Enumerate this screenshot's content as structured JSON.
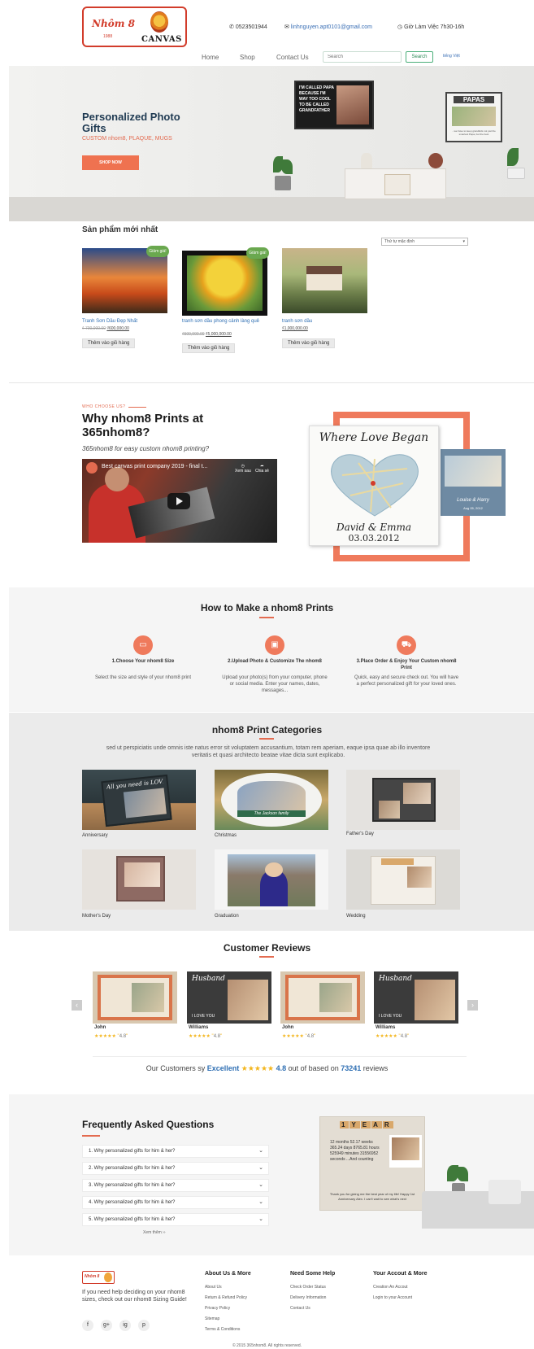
{
  "header": {
    "logo_text": "Nhôm 8",
    "logo_sub": "1988",
    "logo_canvas": "CANVAS",
    "phone": "0523501944",
    "email": "linhnguyen.apt0101@gmail.com",
    "hours": "Giờ Làm Việc 7h30-16h",
    "nav": [
      "Home",
      "Shop",
      "Contact Us"
    ],
    "search_placeholder": "Search",
    "search_button": "Search",
    "language": "tiếng Việt"
  },
  "hero": {
    "title": "Personalized Photo Gifts",
    "subtitle": "CUSTOM nhom8, PLAQUE, MUGS",
    "button": "SHOP NOW",
    "poster1_text": "I'M CALLED PAPA BECAUSE I'M WAY TOO COOL TO BE CALLED GRANDFATHER",
    "poster2_title": "PAPAS",
    "poster2_caption": "...we have to keep grandkids not just the smartest Papa, but the best"
  },
  "products": {
    "title": "Sản phẩm mới nhất",
    "sort_label": "Thứ tự mặc định",
    "sale_badge": "Giảm giá!",
    "items": [
      {
        "name": "Tranh Sơn Dầu Đẹp Nhất",
        "old_price": "₫ 700,000.00",
        "new_price": "₫600,000.00",
        "button": "Thêm vào giỏ hàng"
      },
      {
        "name": "tranh sơn dầu phong cảnh làng quê",
        "old_price": "₫500,000.00",
        "new_price": "₫5,000,000.00",
        "button": "Thêm vào giỏ hàng"
      },
      {
        "name": "tranh sơn dầu",
        "old_price": "",
        "new_price": "₫1,000,000.00",
        "button": "Thêm vào giỏ hàng"
      }
    ]
  },
  "why": {
    "eyebrow": "WHO CHOOSE US?",
    "title": "Why nhom8 Prints at 365nhom8?",
    "subtitle": "365nhom8 for easy custom nhom8 printing?",
    "video_title": "Best canvas print company 2019 - final t...",
    "video_watch_later": "Xem sau",
    "video_share": "Chia sẻ",
    "frame_title": "Where Love Began",
    "frame_names": "David & Emma",
    "frame_date": "03.03.2012",
    "puzzle_names": "Louise & Harry",
    "puzzle_date": "Aug 05, 2012"
  },
  "how": {
    "title": "How to Make a nhom8 Prints",
    "steps": [
      {
        "title": "1.Choose Your nhom8 Size",
        "desc": "Select the size and style of your nhom8 print"
      },
      {
        "title": "2.Upload Photo & Customize The nhom8",
        "desc": "Upload your photo(s) from your computer, phone or social media. Enter your names, dates, messages..."
      },
      {
        "title": "3.Place Order & Enjoy Your Custom nhom8 Print",
        "desc": "Quick, easy and secure check out. You will have a perfect personalized gift for your loved ones."
      }
    ]
  },
  "categories": {
    "title": "nhom8 Print Categories",
    "desc": "sed ut perspiciatis unde omnis iste natus error sit voluptatem accusantium, totam rem aperiam, eaque ipsa quae ab illo inventore veritatis et quasi architecto beatae vitae dicta sunt explicabo.",
    "items": [
      "Anniversary",
      "Christmas",
      "Father's Day",
      "Mother's Day",
      "Graduation",
      "Wedding"
    ],
    "anniversary_text": "All you need is LOVE and Disney",
    "christmas_text": "The Jackson family"
  },
  "reviews": {
    "title": "Customer Reviews",
    "items": [
      {
        "name": "John",
        "rating": "4.8"
      },
      {
        "name": "Williams",
        "rating": "4.8"
      },
      {
        "name": "John",
        "rating": "4.8"
      },
      {
        "name": "Williams",
        "rating": "4.8"
      }
    ],
    "summary_prefix": "Our Customers sy",
    "summary_word": "Excellent",
    "summary_score": "4.8",
    "summary_mid": "out of based on",
    "summary_count": "73241",
    "summary_suffix": "reviews",
    "husband_text": "Husband",
    "love_you": "I LOVE YOU"
  },
  "faq": {
    "title": "Frequently Asked Questions",
    "items": [
      "1. Why personalized gifts for him & her?",
      "2. Why personalized gifts for him & her?",
      "3. Why personalized gifts for him & her?",
      "4. Why personalized gifts for him & her?",
      "5. Why personalized gifts for him & her?"
    ],
    "more": "Xem thêm ››",
    "board_tiles": [
      "1",
      "Y",
      "E",
      "A",
      "R"
    ],
    "board_text": "12 months 52.17 weeks 365.24 days 8765.81 hours 525949 minutes 31556952 seconds ...And counting",
    "board_foot": "Thank you for giving me the best year of my life! Happy 1st Anniversary Alex. I can't wait to see what's next"
  },
  "footer": {
    "help_text": "If you need help deciding on your nhom8 sizes, check out our nhom8 Sizing Guide!",
    "socials": [
      "f",
      "g+",
      "ig",
      "p"
    ],
    "col1_title": "About Us & More",
    "col1_links": [
      "About Us",
      "Return & Refund Policy",
      "Privacy Policy",
      "Sitemap",
      "Terms & Conditions"
    ],
    "col2_title": "Need Some Help",
    "col2_links": [
      "Check Order Status",
      "Delivery Information",
      "Contact Us"
    ],
    "col3_title": "Your Accout & More",
    "col3_links": [
      "Creation An Accout",
      "Login to your Account"
    ],
    "copyright": "© 2015 365nhom8. All rights reserved."
  }
}
